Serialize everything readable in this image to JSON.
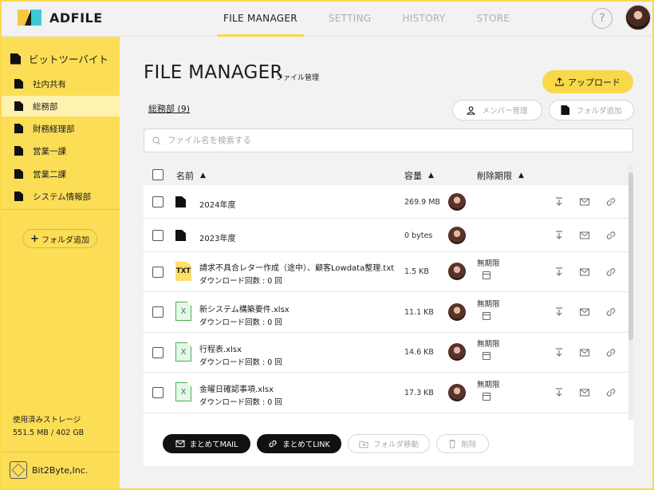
{
  "app": {
    "logo_text": "ADFILE"
  },
  "nav": {
    "tabs": [
      {
        "label": "FILE MANAGER",
        "active": true
      },
      {
        "label": "SETTING",
        "active": false
      },
      {
        "label": "HISTORY",
        "active": false
      },
      {
        "label": "STORE",
        "active": false
      }
    ],
    "help_label": "?"
  },
  "sidebar": {
    "root_label": "ビットツーバイト",
    "items": [
      {
        "label": "社内共有",
        "active": false
      },
      {
        "label": "総務部",
        "active": true
      },
      {
        "label": "財務経理部",
        "active": false
      },
      {
        "label": "営業一課",
        "active": false
      },
      {
        "label": "営業二課",
        "active": false
      },
      {
        "label": "システム情報部",
        "active": false
      }
    ],
    "add_folder_label": "フォルダ追加",
    "storage_label": "使用済みストレージ",
    "storage_value": "551.5 MB / 402 GB",
    "company": "Bit2Byte,Inc."
  },
  "main": {
    "title": "FILE MANAGER",
    "subtitle": "ファイル管理",
    "upload_label": "アップロード",
    "breadcrumb": "総務部 (9)",
    "member_button": "メンバー管理",
    "add_folder_button": "フォルダ追加",
    "search_placeholder": "ファイル名を検索する",
    "columns": {
      "name": "名前",
      "size": "容量",
      "expiry": "削除期限"
    },
    "rows": [
      {
        "type": "folder",
        "name": "2024年度",
        "sub": "",
        "size": "269.9 MB",
        "expiry": ""
      },
      {
        "type": "folder",
        "name": "2023年度",
        "sub": "",
        "size": "0 bytes",
        "expiry": ""
      },
      {
        "type": "txt",
        "name": "請求不具合レター作成（途中）、顧客Lowdata整理.txt",
        "sub": "ダウンロード回数 : 0 回",
        "size": "1.5 KB",
        "expiry": "無期限"
      },
      {
        "type": "xlsx",
        "name": "新システム構築要件.xlsx",
        "sub": "ダウンロード回数 : 0 回",
        "size": "11.1 KB",
        "expiry": "無期限"
      },
      {
        "type": "xlsx",
        "name": "行程表.xlsx",
        "sub": "ダウンロード回数 : 0 回",
        "size": "14.6 KB",
        "expiry": "無期限"
      },
      {
        "type": "xlsx",
        "name": "金曜日確認事項.xlsx",
        "sub": "ダウンロード回数 : 0 回",
        "size": "17.3 KB",
        "expiry": "無期限"
      }
    ],
    "txt_badge": "TXT",
    "xlsx_badge": "X",
    "bulk_mail": "まとめてMAIL",
    "bulk_link": "まとめてLINK",
    "move_folder": "フォルダ移動",
    "delete": "削除"
  },
  "colors": {
    "accent": "#f9d94a",
    "sidebar": "#fcde56",
    "dark_button": "#111111"
  }
}
